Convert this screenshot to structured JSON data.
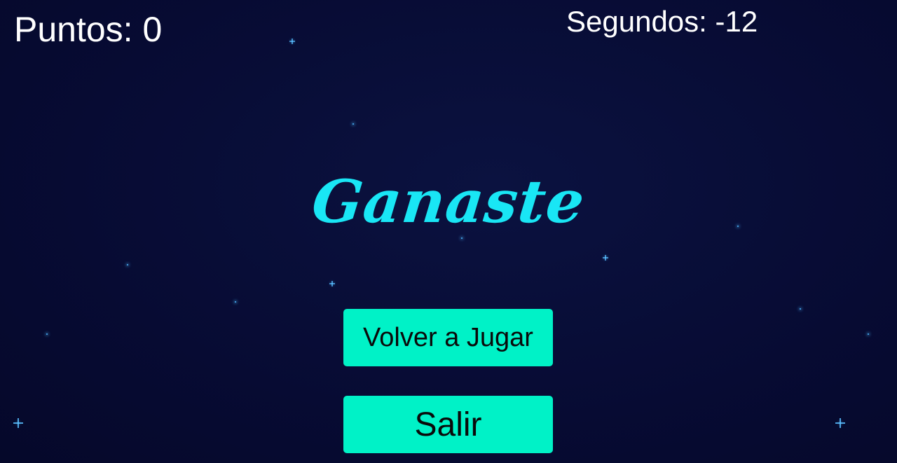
{
  "hud": {
    "score_text": "Puntos: 0",
    "time_text": "Segundos: -12"
  },
  "title": "Ganaste",
  "buttons": {
    "replay_label": "Volver a Jugar",
    "exit_label": "Salir"
  },
  "colors": {
    "background": "#070b33",
    "title": "#19e6f5",
    "button": "#00f2c7",
    "star": "#4fb8ff"
  }
}
